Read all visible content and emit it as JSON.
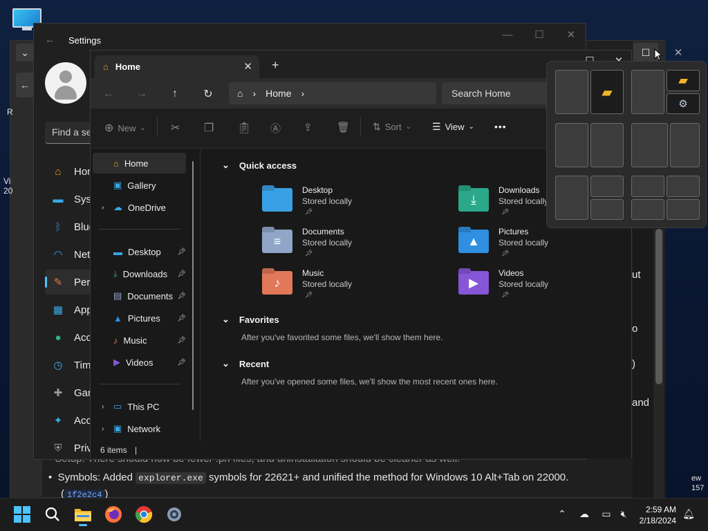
{
  "settings": {
    "title": "Settings",
    "search_placeholder": "Find a se",
    "nav": [
      {
        "label": "Hom",
        "icon": "home-icon",
        "color": "#f0a030"
      },
      {
        "label": "Syst",
        "icon": "monitor-icon",
        "color": "#3aa8e6"
      },
      {
        "label": "Blue",
        "icon": "bluetooth-icon",
        "color": "#2f7fe0"
      },
      {
        "label": "Net",
        "icon": "wifi-icon",
        "color": "#3aa8e6"
      },
      {
        "label": "Pers",
        "icon": "brush-icon",
        "color": "#e07a4a"
      },
      {
        "label": "App",
        "icon": "apps-icon",
        "color": "#3aa8e6"
      },
      {
        "label": "Acc",
        "icon": "person-icon",
        "color": "#2fb58a"
      },
      {
        "label": "Tim",
        "icon": "clock-globe-icon",
        "color": "#3aa8e6"
      },
      {
        "label": "Gan",
        "icon": "gamepad-icon",
        "color": "#9a9a9a"
      },
      {
        "label": "Acc",
        "icon": "accessibility-icon",
        "color": "#3aa8e6"
      },
      {
        "label": "Priv",
        "icon": "shield-icon",
        "color": "#9a9a9a"
      }
    ]
  },
  "browser": {
    "peek": [
      "ut",
      "o",
      ")",
      "and",
      "ew",
      "157"
    ],
    "bullet1_prefix": "Setup: There should now be fewer .pri files, and uninstallation should be cleaner as well.",
    "bullet2_prefix": "Symbols: Added",
    "bullet2_code": "explorer.exe",
    "bullet2_suffix": "symbols for 22621+ and unified the method for Windows 10 Alt+Tab on 22000.",
    "commit_link": "1f2e2c4",
    "side_letters": [
      "R",
      "Vi",
      "20"
    ]
  },
  "explorer": {
    "tab_label": "Home",
    "new_tab": "+",
    "breadcrumb": "Home",
    "search_placeholder": "Search Home",
    "toolbar": {
      "new": "New",
      "sort": "Sort",
      "view": "View",
      "more": "•••"
    },
    "sidebar": {
      "top": [
        {
          "label": "Home",
          "icon": "home-icon",
          "active": true
        },
        {
          "label": "Gallery",
          "icon": "gallery-icon"
        },
        {
          "label": "OneDrive",
          "icon": "cloud-icon",
          "expandable": true
        }
      ],
      "pinned": [
        {
          "label": "Desktop",
          "icon": "desktop-folder-icon"
        },
        {
          "label": "Downloads",
          "icon": "downloads-icon"
        },
        {
          "label": "Documents",
          "icon": "documents-icon"
        },
        {
          "label": "Pictures",
          "icon": "pictures-icon"
        },
        {
          "label": "Music",
          "icon": "music-icon"
        },
        {
          "label": "Videos",
          "icon": "videos-icon"
        }
      ],
      "bottom": [
        {
          "label": "This PC",
          "icon": "pc-icon"
        },
        {
          "label": "Network",
          "icon": "network-icon"
        }
      ]
    },
    "quick_access": {
      "heading": "Quick access",
      "items": [
        {
          "name": "Desktop",
          "sub": "Stored locally",
          "color": "#3aa0e6",
          "glyph": ""
        },
        {
          "name": "Downloads",
          "sub": "Stored locally",
          "color": "#2aa889",
          "glyph": "⤓"
        },
        {
          "name": "Documents",
          "sub": "Stored locally",
          "color": "#8fa6c8",
          "glyph": "≡"
        },
        {
          "name": "Pictures",
          "sub": "Stored locally",
          "color": "#2f8fe0",
          "glyph": "▲"
        },
        {
          "name": "Music",
          "sub": "Stored locally",
          "color": "#e2785a",
          "glyph": "♪"
        },
        {
          "name": "Videos",
          "sub": "Stored locally",
          "color": "#8656d6",
          "glyph": "▶"
        }
      ]
    },
    "favorites": {
      "heading": "Favorites",
      "text": "After you've favorited some files, we'll show them here."
    },
    "recent": {
      "heading": "Recent",
      "text": "After you've opened some files, we'll show the most recent ones here."
    },
    "status": "6 items"
  },
  "taskbar": {
    "apps": [
      "start-icon",
      "search-icon",
      "file-explorer-icon",
      "firefox-icon",
      "chrome-icon",
      "settings-icon"
    ],
    "time": "2:59 AM",
    "date": "2/18/2024"
  }
}
